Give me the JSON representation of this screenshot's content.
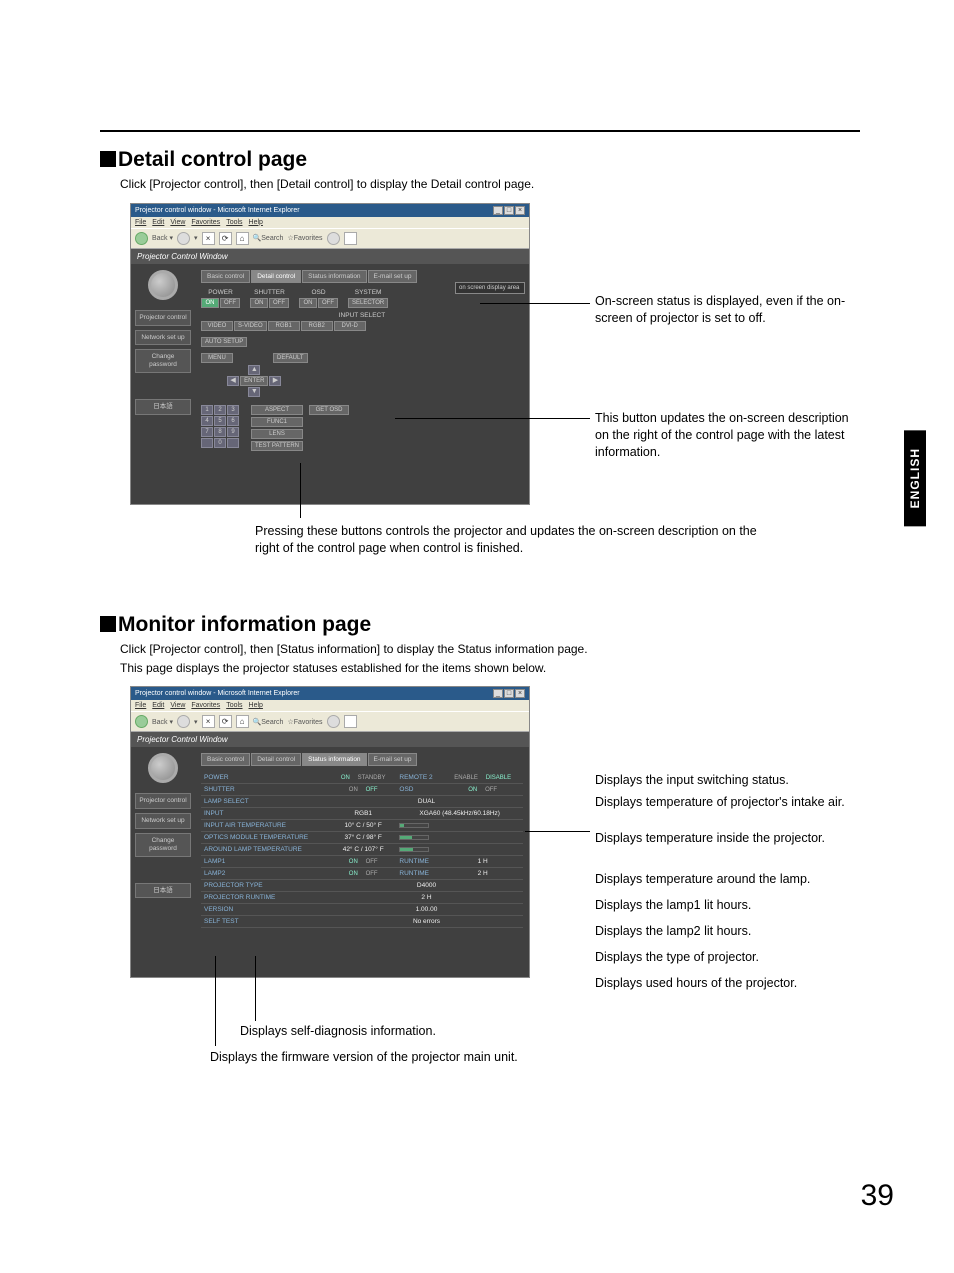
{
  "page_number": "39",
  "language_tab": "ENGLISH",
  "section1": {
    "heading": "Detail control page",
    "desc": "Click [Projector control], then [Detail control] to display the Detail control page.",
    "annotations": {
      "a1": "On-screen status is displayed, even if the on-screen of projector is set to off.",
      "a2": "This button updates the on-screen description on the right of the control page with the latest information.",
      "a3": "Pressing these buttons controls the projector and updates the on-screen description on the right of the control page when control is finished."
    }
  },
  "section2": {
    "heading": "Monitor information page",
    "desc1": "Click [Projector control], then [Status information] to display the Status information page.",
    "desc2": "This page displays the projector statuses established for the items shown below.",
    "annotations": {
      "b1": "Displays the input switching status.",
      "b2": "Displays temperature of projector's intake air.",
      "b3": "Displays temperature inside the projector.",
      "b4": "Displays temperature around the lamp.",
      "b5": "Displays the lamp1 lit hours.",
      "b6": "Displays the lamp2 lit hours.",
      "b7": "Displays the type of projector.",
      "b8": "Displays used hours of the projector.",
      "b9": "Displays self-diagnosis information.",
      "b10": "Displays the firmware version of the projector main unit."
    }
  },
  "browser": {
    "title": "Projector control window - Microsoft Internet Explorer",
    "menus": [
      "File",
      "Edit",
      "View",
      "Favorites",
      "Tools",
      "Help"
    ],
    "tb_search": "Search",
    "tb_fav": "Favorites",
    "content_header": "Projector Control Window",
    "sidebar": {
      "projector_control": "Projector control",
      "network_setup": "Network set up",
      "change_password": "Change password",
      "japanese": "日本語"
    },
    "tabs": {
      "basic": "Basic control",
      "detail": "Detail control",
      "status": "Status information",
      "email": "E-mail set up"
    }
  },
  "detail": {
    "power": "POWER",
    "on": "ON",
    "off": "OFF",
    "shutter": "SHUTTER",
    "osd": "OSD",
    "system": "SYSTEM",
    "selector": "SELECTOR",
    "input_select": "INPUT SELECT",
    "video": "VIDEO",
    "svideo": "S-VIDEO",
    "rgb1": "RGB1",
    "rgb2": "RGB2",
    "dvid": "DVI-D",
    "auto_setup": "AUTO SETUP",
    "menu": "MENU",
    "default": "DEFAULT",
    "enter": "ENTER",
    "aspect": "ASPECT",
    "func1": "FUNC1",
    "lens": "LENS",
    "test_pattern": "TEST PATTERN",
    "get_osd": "GET OSD",
    "osd_display": "on screen display area"
  },
  "status": {
    "rows": {
      "power": "POWER",
      "power_on": "ON",
      "standby": "STANDBY",
      "remote2": "REMOTE 2",
      "enable": "ENABLE",
      "disable": "DISABLE",
      "shutter": "SHUTTER",
      "osd": "OSD",
      "lamp_select": "LAMP SELECT",
      "dual": "DUAL",
      "input": "INPUT",
      "rgb1": "RGB1",
      "signal": "XGA60 (48.45kHz/60.18Hz)",
      "input_air": "INPUT AIR TEMPERATURE",
      "t1": "10° C / 50° F",
      "optics": "OPTICS MODULE TEMPERATURE",
      "t2": "37° C / 98° F",
      "around": "AROUND LAMP TEMPERATURE",
      "t3": "42° C / 107° F",
      "lamp1": "LAMP1",
      "runtime": "RUNTIME",
      "h1": "1 H",
      "lamp2": "LAMP2",
      "h2": "2 H",
      "ptype": "PROJECTOR TYPE",
      "ptype_v": "D4000",
      "pruntime": "PROJECTOR RUNTIME",
      "pr_v": "2 H",
      "version": "VERSION",
      "ver_v": "1.00.00",
      "selftest": "SELF TEST",
      "st_v": "No errors",
      "on": "ON",
      "off": "OFF"
    }
  }
}
